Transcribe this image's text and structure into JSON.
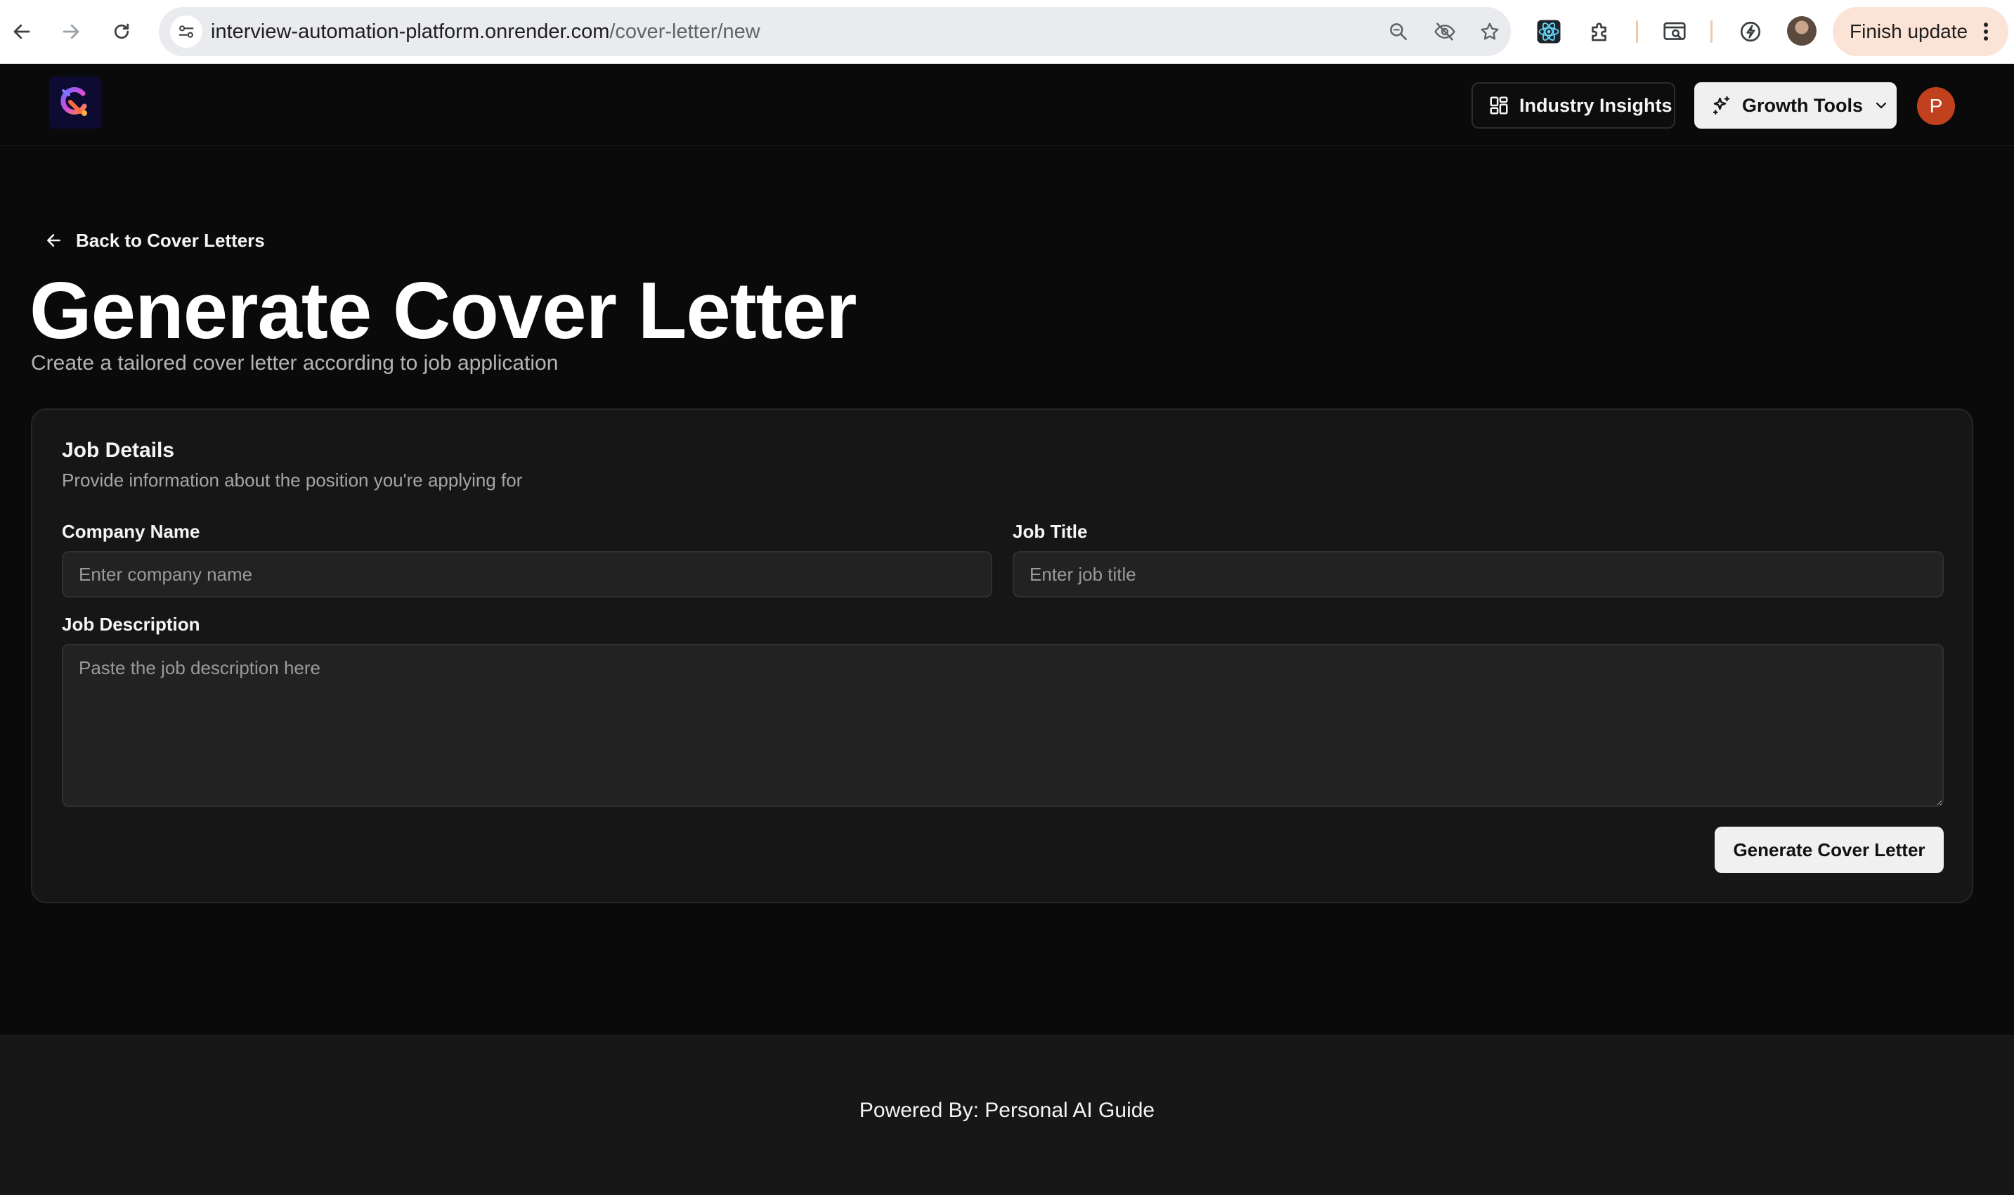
{
  "browser": {
    "url_host": "interview-automation-platform.onrender.com",
    "url_path": "/cover-letter/new",
    "finish_update_label": "Finish update",
    "icons": [
      "back-arrow-icon",
      "forward-arrow-icon",
      "reload-icon",
      "site-settings-icon",
      "zoom-icon",
      "eye-off-icon",
      "star-icon",
      "react-devtools-icon",
      "extensions-puzzle-icon",
      "tab-search-icon",
      "performance-icon",
      "profile-avatar",
      "more-vert-icon"
    ]
  },
  "header": {
    "nav": [
      {
        "label": "Industry Insights",
        "icon": "dashboard-grid-icon"
      },
      {
        "label": "Growth Tools",
        "icon": "sparkle-icon"
      }
    ],
    "avatar_initial": "P",
    "colors": {
      "avatar_bg": "#c1411f",
      "primary_button_bg": "#f0f0f0"
    }
  },
  "main": {
    "back_link": "Back to Cover Letters",
    "title": "Generate Cover Letter",
    "subtitle": "Create a tailored cover letter according to job application",
    "card": {
      "title": "Job Details",
      "description": "Provide information about the position you're applying for",
      "company_label": "Company Name",
      "company_value": "",
      "company_placeholder": "Enter company name",
      "job_title_label": "Job Title",
      "job_title_value": "",
      "job_title_placeholder": "Enter job title",
      "job_description_label": "Job Description",
      "job_description_value": "",
      "job_description_placeholder": "Paste the job description here",
      "submit_label": "Generate Cover Letter"
    }
  },
  "footer": {
    "text": "Powered By: Personal AI Guide"
  }
}
